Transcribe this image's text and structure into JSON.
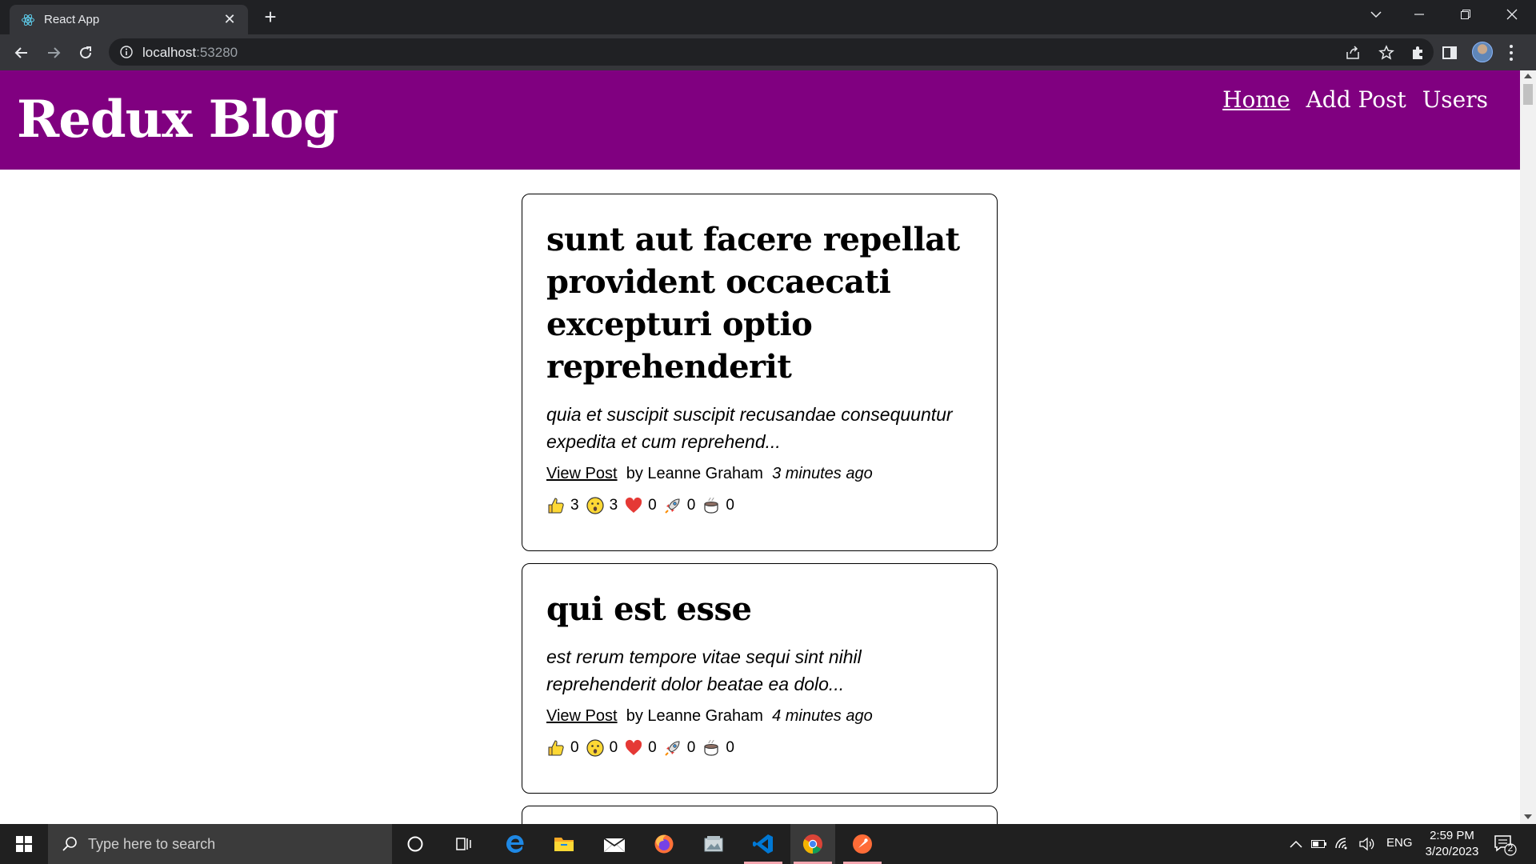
{
  "browser": {
    "tab_title": "React App",
    "new_tab_symbol": "+",
    "url_host": "localhost",
    "url_port": ":53280"
  },
  "site": {
    "title": "Redux Blog",
    "nav": {
      "home": "Home",
      "add_post": "Add Post",
      "users": "Users"
    }
  },
  "posts": [
    {
      "title": "sunt aut facere repellat provident occaecati excepturi optio reprehenderit",
      "excerpt": "quia et suscipit suscipit recusandae consequuntur expedita et cum reprehend...",
      "view_label": "View Post",
      "author": "by Leanne Graham",
      "time": "3 minutes ago",
      "reactions": {
        "thumbsUp": "3",
        "wow": "3",
        "heart": "0",
        "rocket": "0",
        "coffee": "0"
      }
    },
    {
      "title": "qui est esse",
      "excerpt": "est rerum tempore vitae sequi sint nihil reprehenderit dolor beatae ea dolo...",
      "view_label": "View Post",
      "author": "by Leanne Graham",
      "time": "4 minutes ago",
      "reactions": {
        "thumbsUp": "0",
        "wow": "0",
        "heart": "0",
        "rocket": "0",
        "coffee": "0"
      }
    }
  ],
  "taskbar": {
    "search_placeholder": "Type here to search",
    "language": "ENG",
    "time": "2:59 PM",
    "date": "3/20/2023",
    "notification_count": "2"
  }
}
